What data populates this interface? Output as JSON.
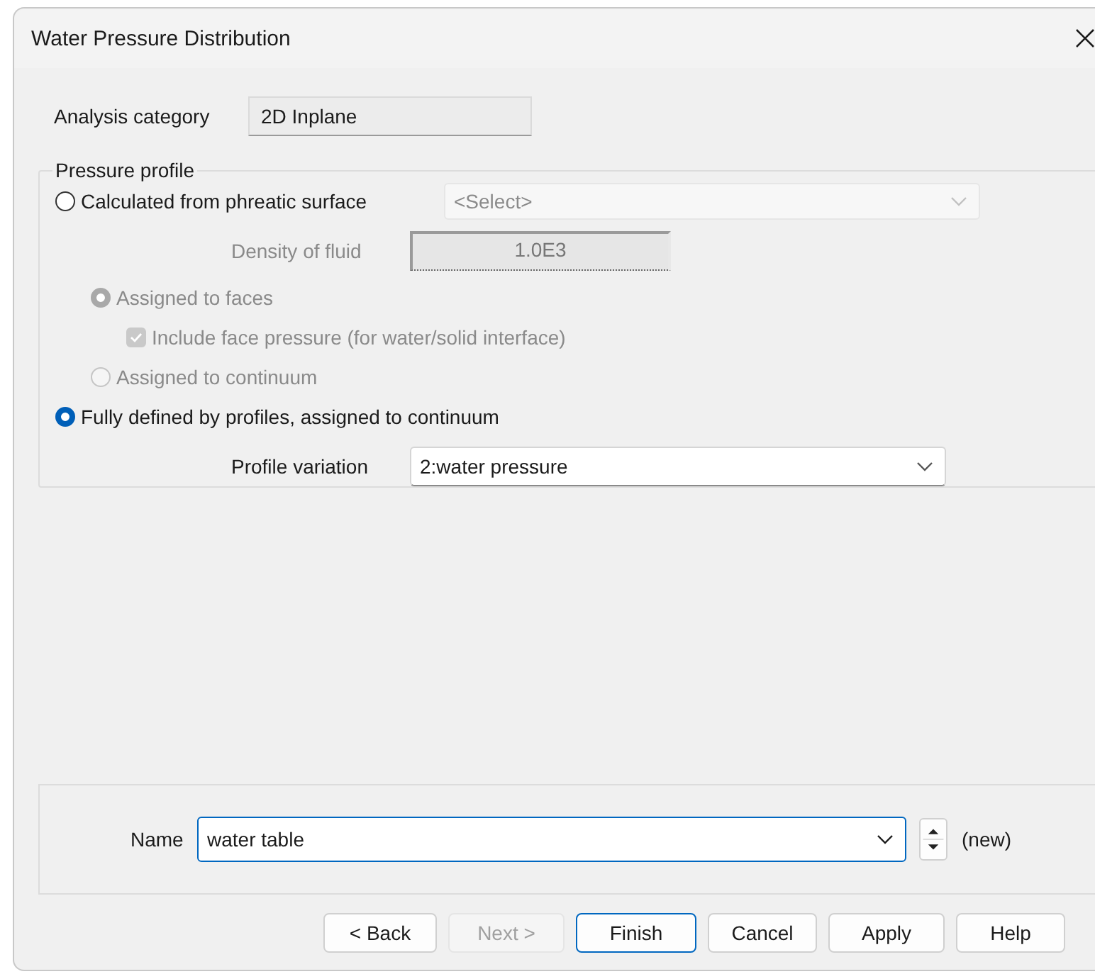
{
  "window": {
    "title": "Water Pressure Distribution"
  },
  "analysis_category": {
    "label": "Analysis category",
    "value": "2D Inplane"
  },
  "pressure_profile": {
    "title": "Pressure profile",
    "rows": [
      {
        "kind": "radio",
        "label": "Calculated from phreatic surface",
        "selected": false,
        "disabled": false,
        "combo": {
          "value": "<Select>",
          "disabled": true
        },
        "children": [
          {
            "kind": "field",
            "label": "Density of fluid",
            "value": "1.0E3",
            "disabled": true
          },
          {
            "kind": "radio",
            "label": "Assigned to faces",
            "selected": true,
            "disabled": true,
            "children": [
              {
                "kind": "checkbox",
                "label": "Include face pressure (for water/solid interface)",
                "checked": true,
                "disabled": true
              }
            ]
          },
          {
            "kind": "radio",
            "label": "Assigned to continuum",
            "selected": false,
            "disabled": true
          }
        ]
      },
      {
        "kind": "radio",
        "label": "Fully defined by profiles, assigned to continuum",
        "selected": true,
        "disabled": false
      },
      {
        "kind": "combo",
        "label": "Profile variation",
        "value": "2:water pressure",
        "disabled": false
      }
    ]
  },
  "name_row": {
    "label": "Name",
    "value": "water table",
    "focused": true,
    "status": "(new)"
  },
  "buttons": [
    {
      "label": "< Back",
      "disabled": false,
      "default": false
    },
    {
      "label": "Next >",
      "disabled": true,
      "default": false
    },
    {
      "label": "Finish",
      "disabled": false,
      "default": true
    },
    {
      "label": "Cancel",
      "disabled": false,
      "default": false
    },
    {
      "label": "Apply",
      "disabled": false,
      "default": false
    },
    {
      "label": "Help",
      "disabled": false,
      "default": false
    }
  ]
}
